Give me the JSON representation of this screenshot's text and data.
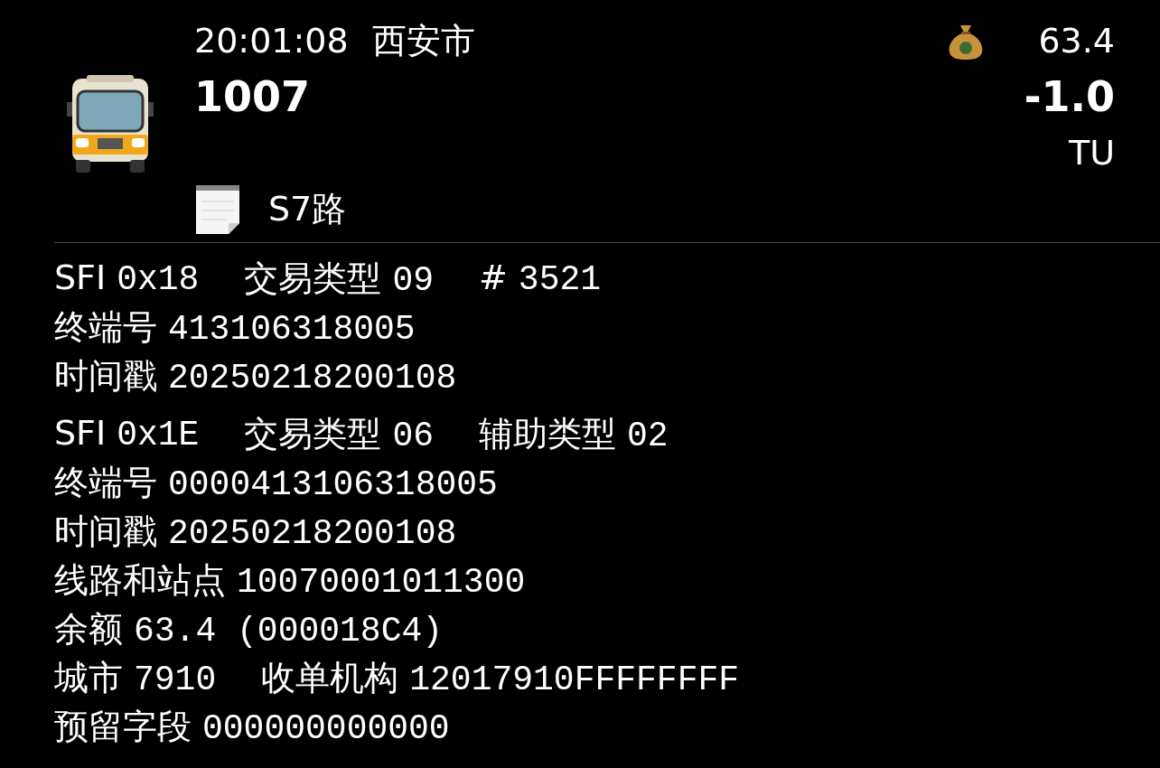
{
  "header": {
    "time": "20:01:08",
    "city": "西安市",
    "card_number": "1007",
    "balance": "63.4",
    "amount": "-1.0",
    "unit": "TU",
    "route": "S7路"
  },
  "records": [
    {
      "lines": [
        [
          {
            "label": "SFI",
            "value": "0x18"
          },
          {
            "label": "交易类型",
            "value": "09"
          },
          {
            "label": "#",
            "value": "3521"
          }
        ],
        [
          {
            "label": "终端号",
            "value": "413106318005"
          }
        ],
        [
          {
            "label": "时间戳",
            "value": "20250218200108"
          }
        ]
      ]
    },
    {
      "lines": [
        [
          {
            "label": "SFI",
            "value": "0x1E"
          },
          {
            "label": "交易类型",
            "value": "06"
          },
          {
            "label": "辅助类型",
            "value": "02"
          }
        ],
        [
          {
            "label": "终端号",
            "value": "0000413106318005"
          }
        ],
        [
          {
            "label": "时间戳",
            "value": "20250218200108"
          }
        ],
        [
          {
            "label": "线路和站点",
            "value": "10070001011300"
          }
        ],
        [
          {
            "label": "余额",
            "value": "63.4 (000018C4)"
          }
        ],
        [
          {
            "label": "城市",
            "value": "7910"
          },
          {
            "label": "收单机构",
            "value": "12017910FFFFFFFF"
          }
        ],
        [
          {
            "label": "预留字段",
            "value": "000000000000"
          }
        ]
      ]
    }
  ]
}
